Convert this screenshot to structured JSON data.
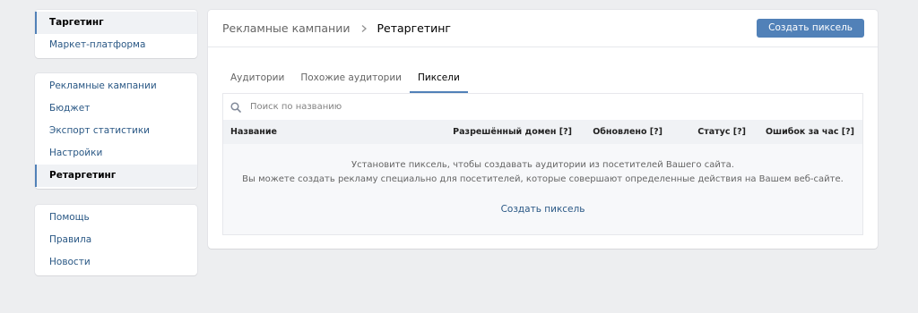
{
  "sidebar": {
    "group1": [
      {
        "label": "Таргетинг",
        "active": true
      },
      {
        "label": "Маркет-платформа",
        "active": false
      }
    ],
    "group2": [
      {
        "label": "Рекламные кампании",
        "active": false
      },
      {
        "label": "Бюджет",
        "active": false
      },
      {
        "label": "Экспорт статистики",
        "active": false
      },
      {
        "label": "Настройки",
        "active": false
      },
      {
        "label": "Ретаргетинг",
        "active": true
      }
    ],
    "group3": [
      {
        "label": "Помощь",
        "active": false
      },
      {
        "label": "Правила",
        "active": false
      },
      {
        "label": "Новости",
        "active": false
      }
    ]
  },
  "header": {
    "breadcrumb_root": "Рекламные кампании",
    "breadcrumb_current": "Ретаргетинг",
    "create_button": "Создать пиксель"
  },
  "tabs": [
    {
      "label": "Аудитории",
      "active": false
    },
    {
      "label": "Похожие аудитории",
      "active": false
    },
    {
      "label": "Пиксели",
      "active": true
    }
  ],
  "search": {
    "placeholder": "Поиск по названию"
  },
  "table": {
    "columns": {
      "name": "Название",
      "domain": "Разрешённый домен [?]",
      "updated": "Обновлено [?]",
      "status": "Статус [?]",
      "errors": "Ошибок за час [?]"
    }
  },
  "empty_state": {
    "line1": "Установите пиксель, чтобы создавать аудитории из посетителей Вашего сайта.",
    "line2": "Вы можете создать рекламу специально для посетителей, которые совершают определенные действия на Вашем веб-сайте.",
    "link": "Создать пиксель"
  },
  "colors": {
    "accent": "#5181b8",
    "link": "#2a5885",
    "background": "#edeef0"
  }
}
